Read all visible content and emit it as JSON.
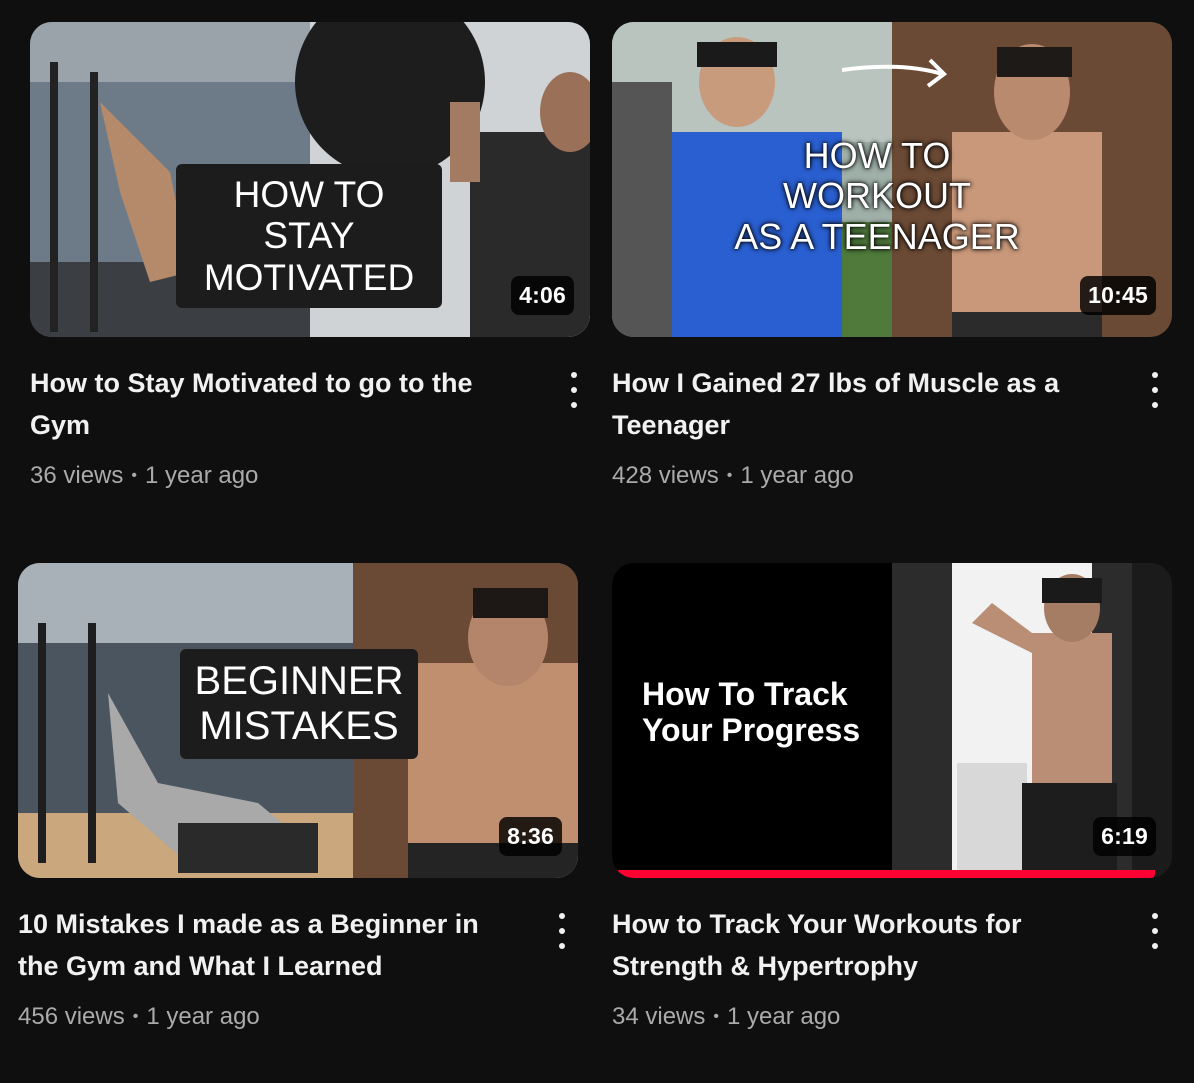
{
  "videos": [
    {
      "title": "How to Stay Motivated to go to the Gym",
      "views": "36 views",
      "age": "1 year ago",
      "duration": "4:06",
      "thumbnail_text": "HOW TO STAY\nMOTIVATED"
    },
    {
      "title": "How I Gained 27 lbs of Muscle as a Teenager",
      "views": "428 views",
      "age": "1 year ago",
      "duration": "10:45",
      "thumbnail_text": "HOW TO WORKOUT\nAS A TEENAGER"
    },
    {
      "title": "10 Mistakes I made as a Beginner in the Gym and What I Learned",
      "views": "456 views",
      "age": "1 year ago",
      "duration": "8:36",
      "thumbnail_text": "BEGINNER\nMISTAKES"
    },
    {
      "title": "How to Track Your Workouts for Strength & Hypertrophy",
      "views": "34 views",
      "age": "1 year ago",
      "duration": "6:19",
      "thumbnail_text": "How To Track\nYour Progress",
      "watch_progress": 0.98
    }
  ],
  "meta_separator": "•",
  "colors": {
    "background": "#0f0f0f",
    "title_text": "#f1f1f1",
    "meta_text": "#aaaaaa",
    "progress_bar": "#ff0033"
  }
}
